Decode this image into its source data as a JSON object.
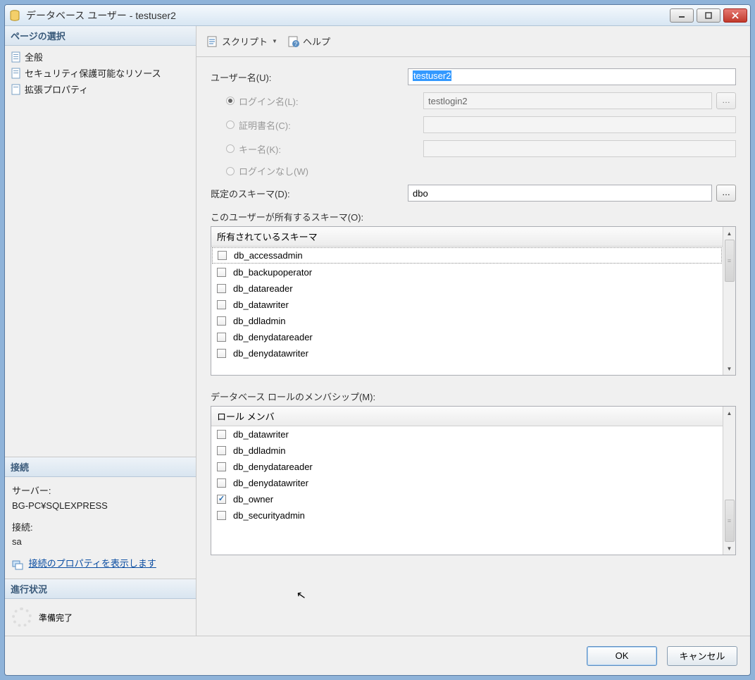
{
  "window": {
    "title": "データベース ユーザー - testuser2"
  },
  "left": {
    "pages_header": "ページの選択",
    "pages": [
      {
        "label": "全般"
      },
      {
        "label": "セキュリティ保護可能なリソース"
      },
      {
        "label": "拡張プロパティ"
      }
    ],
    "connection_header": "接続",
    "server_label": "サーバー:",
    "server_value": "BG-PC¥SQLEXPRESS",
    "conn_label": "接続:",
    "conn_value": "sa",
    "conn_link": "接続のプロパティを表示します",
    "progress_header": "進行状況",
    "progress_status": "準備完了"
  },
  "toolbar": {
    "script": "スクリプト",
    "help": "ヘルプ"
  },
  "form": {
    "username_label": "ユーザー名(U):",
    "username_value": "testuser2",
    "login_label": "ログイン名(L):",
    "login_value": "testlogin2",
    "cert_label": "証明書名(C):",
    "key_label": "キー名(K):",
    "nologin_label": "ログインなし(W)",
    "schema_label": "既定のスキーマ(D):",
    "schema_value": "dbo",
    "owned_label": "このユーザーが所有するスキーマ(O):",
    "owned_header": "所有されているスキーマ",
    "owned_items": [
      {
        "label": "db_accessadmin",
        "checked": false
      },
      {
        "label": "db_backupoperator",
        "checked": false
      },
      {
        "label": "db_datareader",
        "checked": false
      },
      {
        "label": "db_datawriter",
        "checked": false
      },
      {
        "label": "db_ddladmin",
        "checked": false
      },
      {
        "label": "db_denydatareader",
        "checked": false
      },
      {
        "label": "db_denydatawriter",
        "checked": false
      }
    ],
    "roles_label": "データベース ロールのメンバシップ(M):",
    "roles_header": "ロール メンバ",
    "roles_items": [
      {
        "label": "db_datawriter",
        "checked": false
      },
      {
        "label": "db_ddladmin",
        "checked": false
      },
      {
        "label": "db_denydatareader",
        "checked": false
      },
      {
        "label": "db_denydatawriter",
        "checked": false
      },
      {
        "label": "db_owner",
        "checked": true
      },
      {
        "label": "db_securityadmin",
        "checked": false
      }
    ]
  },
  "buttons": {
    "ok": "OK",
    "cancel": "キャンセル"
  }
}
